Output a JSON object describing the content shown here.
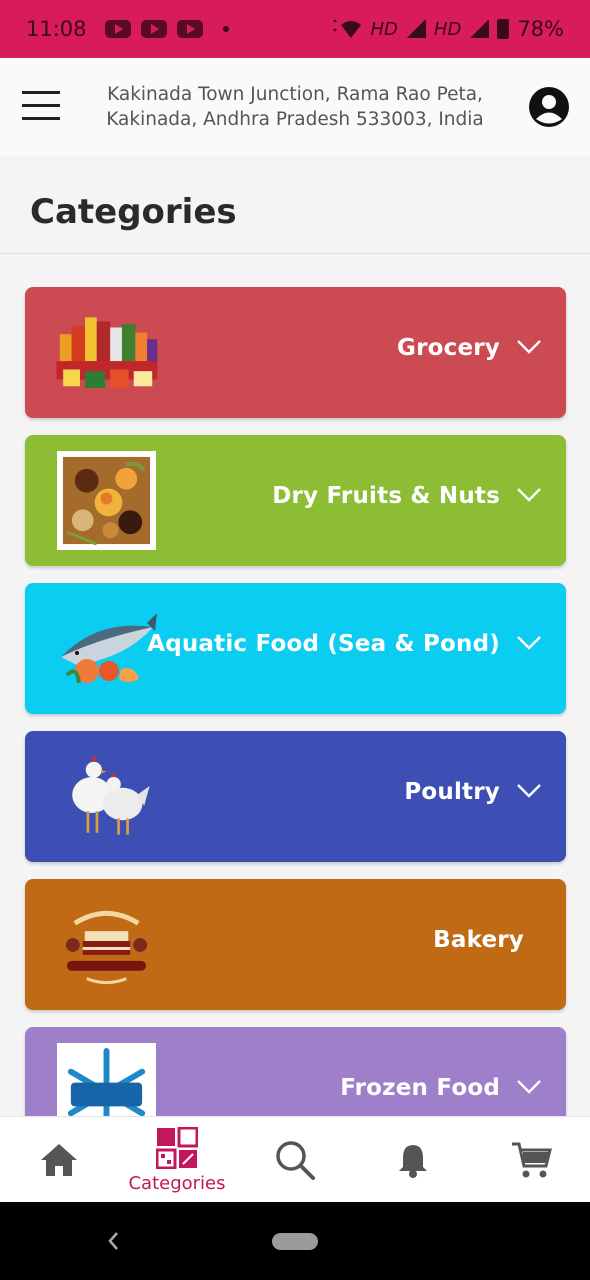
{
  "status_bar": {
    "time": "11:08",
    "network_1": "HD",
    "network_2": "HD",
    "battery": "78%"
  },
  "header": {
    "address_line1": "Kakinada Town Junction, Rama Rao Peta,",
    "address_line2": "Kakinada, Andhra Pradesh 533003, India"
  },
  "page": {
    "title": "Categories"
  },
  "categories": [
    {
      "label": "Grocery",
      "color": "#cc4a52",
      "icon": "grocery-image",
      "chevron": true
    },
    {
      "label": "Dry Fruits & Nuts",
      "color": "#8cbd34",
      "icon": "dry-fruits-image",
      "chevron": true
    },
    {
      "label": "Aquatic Food (Sea & Pond)",
      "color": "#0bcdf2",
      "icon": "fish-image",
      "chevron": true
    },
    {
      "label": "Poultry",
      "color": "#3d4fb4",
      "icon": "chicken-image",
      "chevron": true
    },
    {
      "label": "Bakery",
      "color": "#c16a16",
      "icon": "cake-image",
      "chevron": false
    },
    {
      "label": "Frozen Food",
      "color": "#9d7fca",
      "icon": "frozen-image",
      "chevron": true
    }
  ],
  "bottom_nav": {
    "categories_label": "Categories",
    "active_color": "#c2185b"
  }
}
